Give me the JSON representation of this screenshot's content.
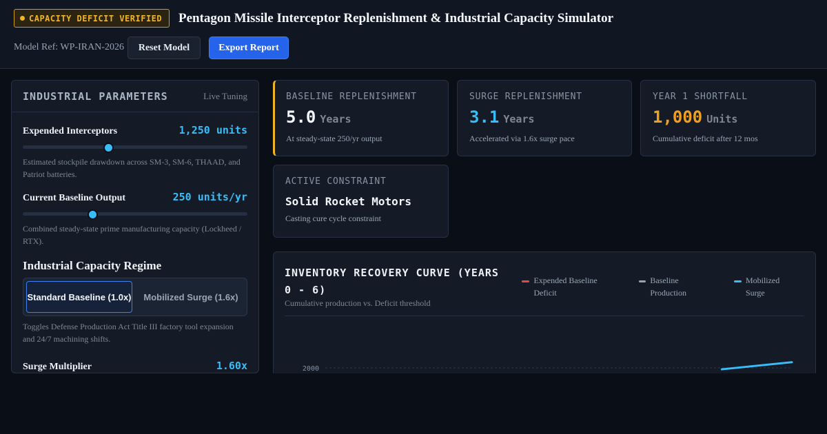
{
  "header": {
    "badge": "CAPACITY DEFICIT VERIFIED",
    "title": "Pentagon Missile Interceptor Replenishment & Industrial Capacity Simulator",
    "model_ref": "Model Ref: WP-IRAN-2026",
    "reset_label": "Reset Model",
    "export_label": "Export Report"
  },
  "params": {
    "title": "INDUSTRIAL PARAMETERS",
    "subtitle": "Live Tuning",
    "expended": {
      "label": "Expended Interceptors",
      "value": "1,250 units",
      "level": 0.38,
      "desc": "Estimated stockpile drawdown across SM-3, SM-6, THAAD, and Patriot batteries."
    },
    "baseline": {
      "label": "Current Baseline Output",
      "value": "250 units/yr",
      "level": 0.31,
      "desc": "Combined steady-state prime manufacturing capacity (Lockheed / RTX)."
    },
    "regime": {
      "title": "Industrial Capacity Regime",
      "option_standard": "Standard Baseline (1.0x)",
      "option_surge": "Mobilized Surge (1.6x)",
      "selected": "Standard Baseline (1.0x)",
      "desc": "Toggles Defense Production Act Title III factory tool expansion and 24/7 machining shifts."
    },
    "surge": {
      "label": "Surge Multiplier",
      "value": "1.60x"
    }
  },
  "cards": {
    "baseline": {
      "label": "BASELINE REPLENISHMENT",
      "value": "5.0",
      "unit": "Years",
      "note": "At steady-state 250/yr output",
      "color": "#f3f6fa",
      "accent": "#f0b429"
    },
    "surge": {
      "label": "SURGE REPLENISHMENT",
      "value": "3.1",
      "unit": "Years",
      "note": "Accelerated via 1.6x surge pace",
      "color": "#38bdf8"
    },
    "shortfall": {
      "label": "YEAR 1 SHORTFALL",
      "value": "1,000",
      "unit": "Units",
      "note": "Cumulative deficit after 12 mos",
      "color": "#f0a020"
    },
    "constraint": {
      "label": "ACTIVE CONSTRAINT",
      "value": "Solid Rocket Motors",
      "note": "Casting cure cycle constraint"
    }
  },
  "chart": {
    "title": "INVENTORY RECOVERY CURVE (YEARS 0 - 6)",
    "subtitle": "Cumulative production vs. Deficit threshold",
    "legend": [
      {
        "name": "Expended Baseline Deficit",
        "color": "#ef4444"
      },
      {
        "name": "Baseline Production",
        "color": "#9ca3af"
      },
      {
        "name": "Mobilized Surge",
        "color": "#38bdf8"
      }
    ]
  },
  "chart_data": {
    "type": "line",
    "title": "INVENTORY RECOVERY CURVE (YEARS 0 - 6)",
    "y_ticks": [
      2000
    ],
    "grid": true,
    "legend_position": "top-right",
    "series": [
      {
        "name": "Mobilized Surge",
        "x": [
          5.1,
          6
        ],
        "y": [
          1900,
          2400
        ]
      }
    ]
  }
}
